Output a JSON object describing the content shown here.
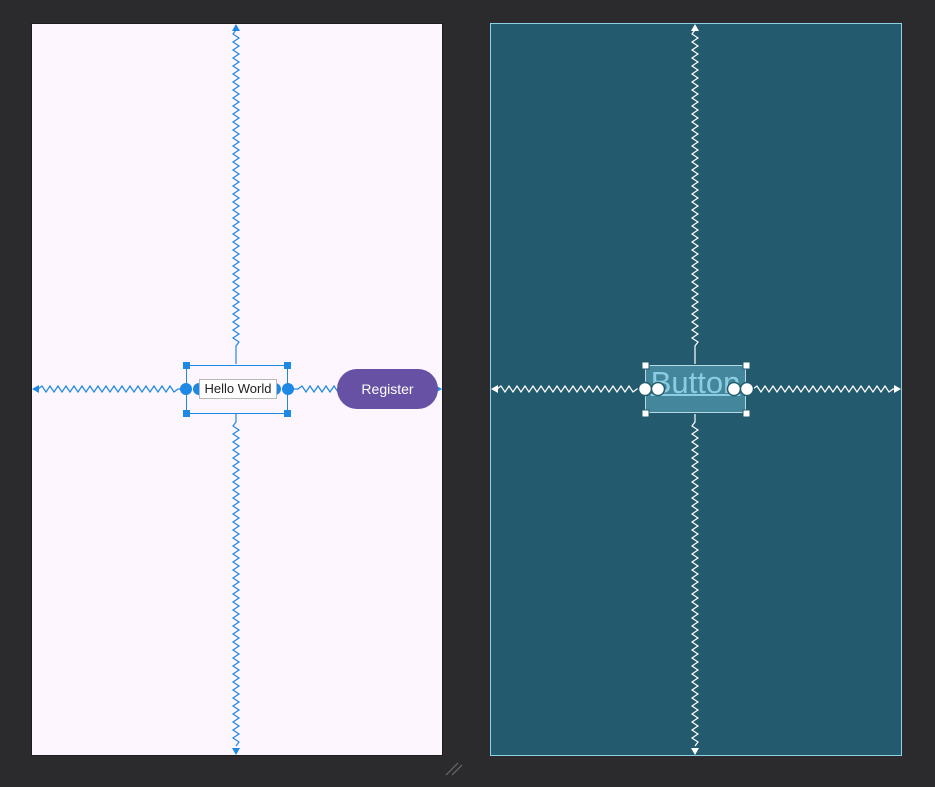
{
  "design": {
    "text_view": {
      "text": "Hello World"
    },
    "register_button": {
      "label": "Register"
    }
  },
  "blueprint": {
    "button": {
      "label": "Button"
    }
  },
  "colors": {
    "canvas_bg": "#2b2b2d",
    "design_bg": "#fdf6ff",
    "blueprint_bg": "#235a6d",
    "constraint_blue": "#1e88e5",
    "blueprint_line": "#ffffff",
    "button_purple": "#6751a4"
  }
}
